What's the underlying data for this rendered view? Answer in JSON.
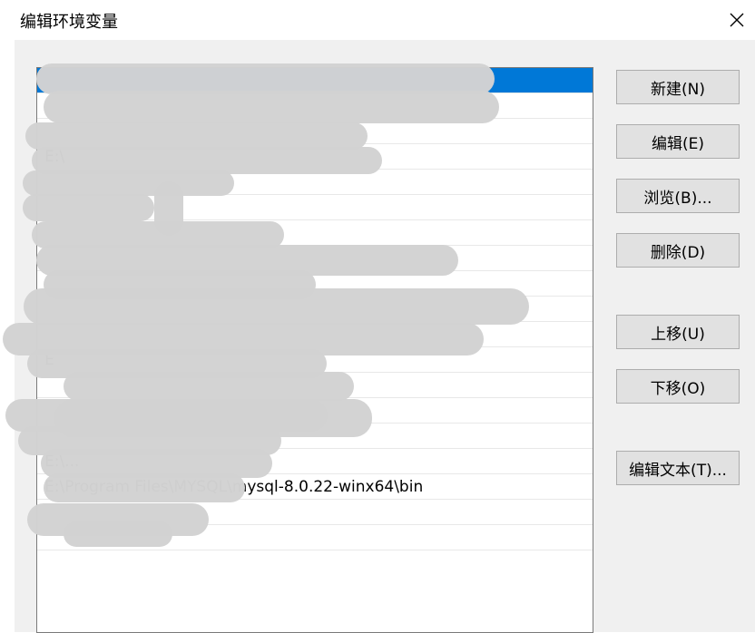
{
  "window": {
    "title": "编辑环境变量"
  },
  "list": {
    "items": [
      {
        "text": "",
        "selected": true
      },
      {
        "text": ""
      },
      {
        "text": ""
      },
      {
        "text": "E:\\"
      },
      {
        "text": ""
      },
      {
        "text": ""
      },
      {
        "text": ""
      },
      {
        "text": ""
      },
      {
        "text": ""
      },
      {
        "text": ""
      },
      {
        "text": ""
      },
      {
        "text": "E"
      },
      {
        "text": ""
      },
      {
        "text": ""
      },
      {
        "text": ""
      },
      {
        "text": "E:\\..."
      },
      {
        "text": "E:\\Program Files\\MYSQL\\mysql-8.0.22-winx64\\bin"
      },
      {
        "text": ""
      },
      {
        "text": ""
      }
    ]
  },
  "buttons": {
    "new": "新建(N)",
    "edit": "编辑(E)",
    "browse": "浏览(B)...",
    "delete": "删除(D)",
    "move_up": "上移(U)",
    "move_down": "下移(O)",
    "edit_text": "编辑文本(T)..."
  },
  "colors": {
    "selection": "#0078d7",
    "redaction": "#d2d2d2"
  },
  "icons": {
    "close": "close-icon"
  }
}
